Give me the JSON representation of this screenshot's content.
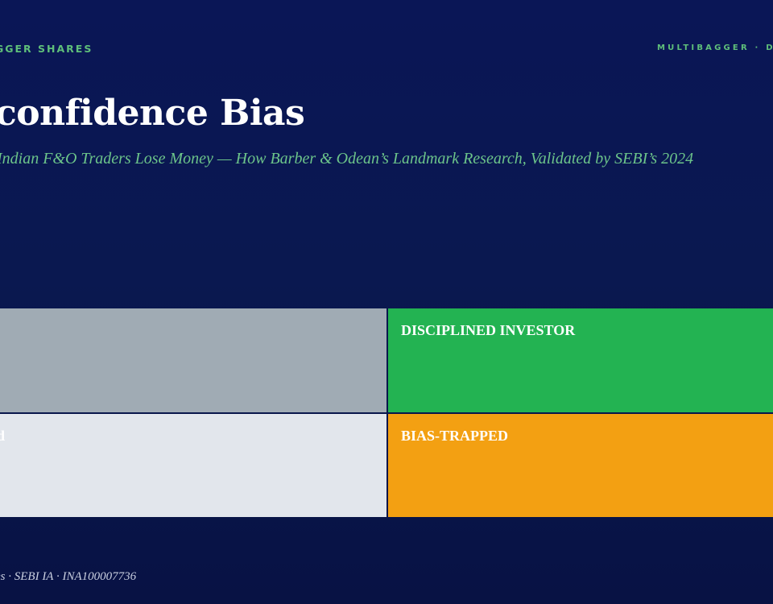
{
  "header": {
    "brand_left": "GGER SHARES",
    "brand_right": "MULTIBAGGER · D"
  },
  "slide": {
    "title": "confidence Bias",
    "subtitle": "Indian F&O Traders Lose Money — How Barber & Odean’s Landmark Research, Validated by SEBI’s 2024"
  },
  "matrix": {
    "cells": [
      {
        "label": "",
        "color": "#a0abb4"
      },
      {
        "label": "DISCIPLINED INVESTOR",
        "color": "#23b352"
      },
      {
        "label": "d",
        "color": "#e2e6ec"
      },
      {
        "label": "BIAS-TRAPPED",
        "color": "#f3a012"
      }
    ]
  },
  "footer": {
    "text": "es · SEBI IA · INA100007736"
  }
}
